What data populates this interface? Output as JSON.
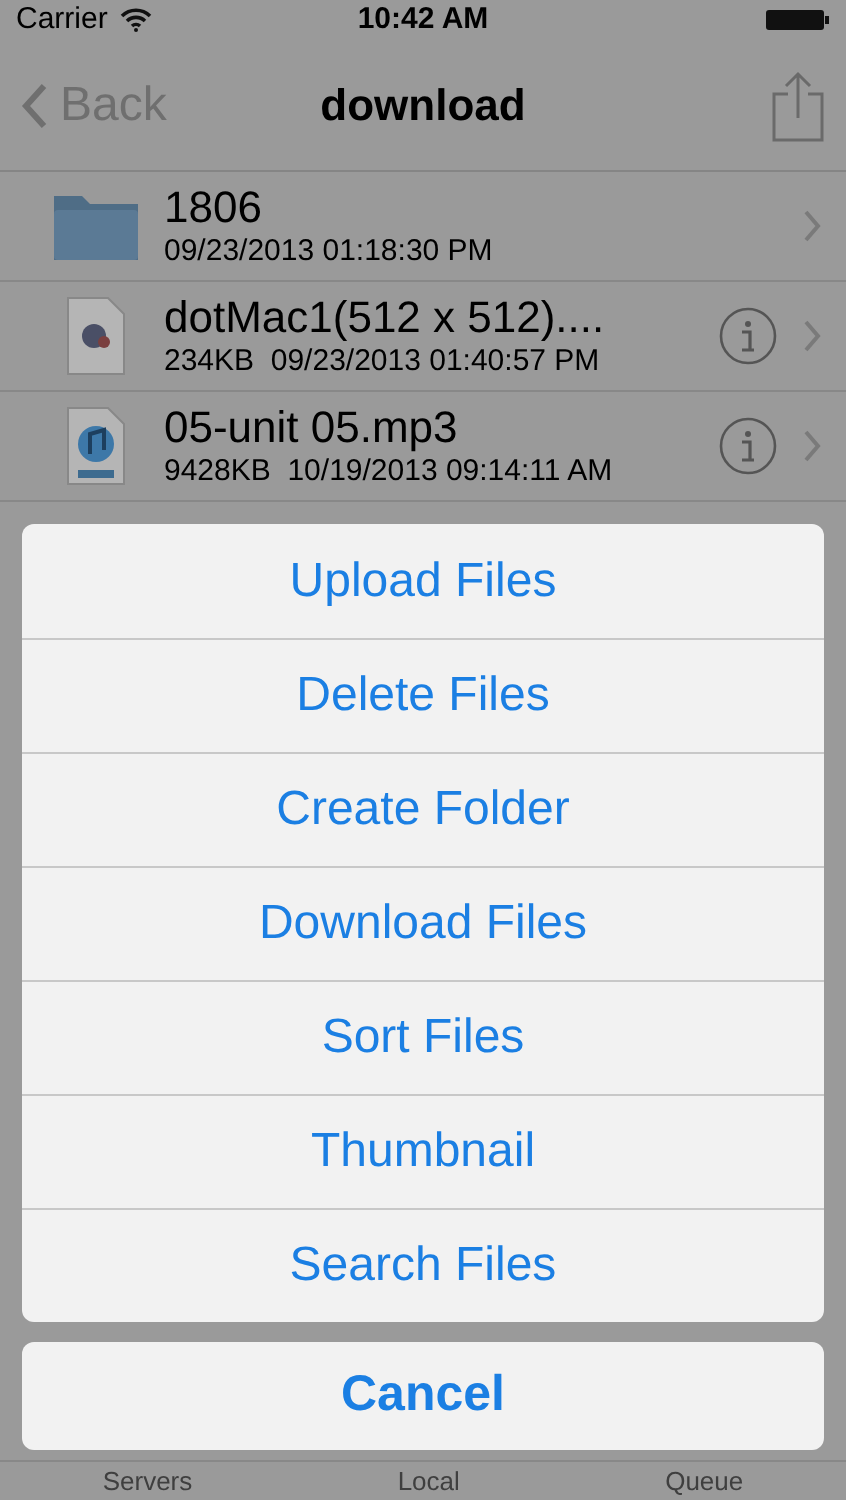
{
  "status_bar": {
    "carrier": "Carrier",
    "time": "10:42 AM"
  },
  "nav_bar": {
    "back": "Back",
    "title": "download"
  },
  "files": [
    {
      "kind": "folder",
      "name": "1806",
      "details": "09/23/2013 01:18:30 PM"
    },
    {
      "kind": "image",
      "name": "dotMac1(512 x 512)....",
      "details": "234KB  09/23/2013 01:40:57 PM"
    },
    {
      "kind": "audio",
      "name": "05-unit 05.mp3",
      "details": "9428KB  10/19/2013 09:14:11 AM"
    }
  ],
  "action_sheet": {
    "actions": [
      "Upload Files",
      "Delete Files",
      "Create Folder",
      "Download Files",
      "Sort Files",
      "Thumbnail",
      "Search Files"
    ],
    "cancel": "Cancel"
  },
  "tab_bar": [
    "Servers",
    "Local",
    "Queue"
  ]
}
